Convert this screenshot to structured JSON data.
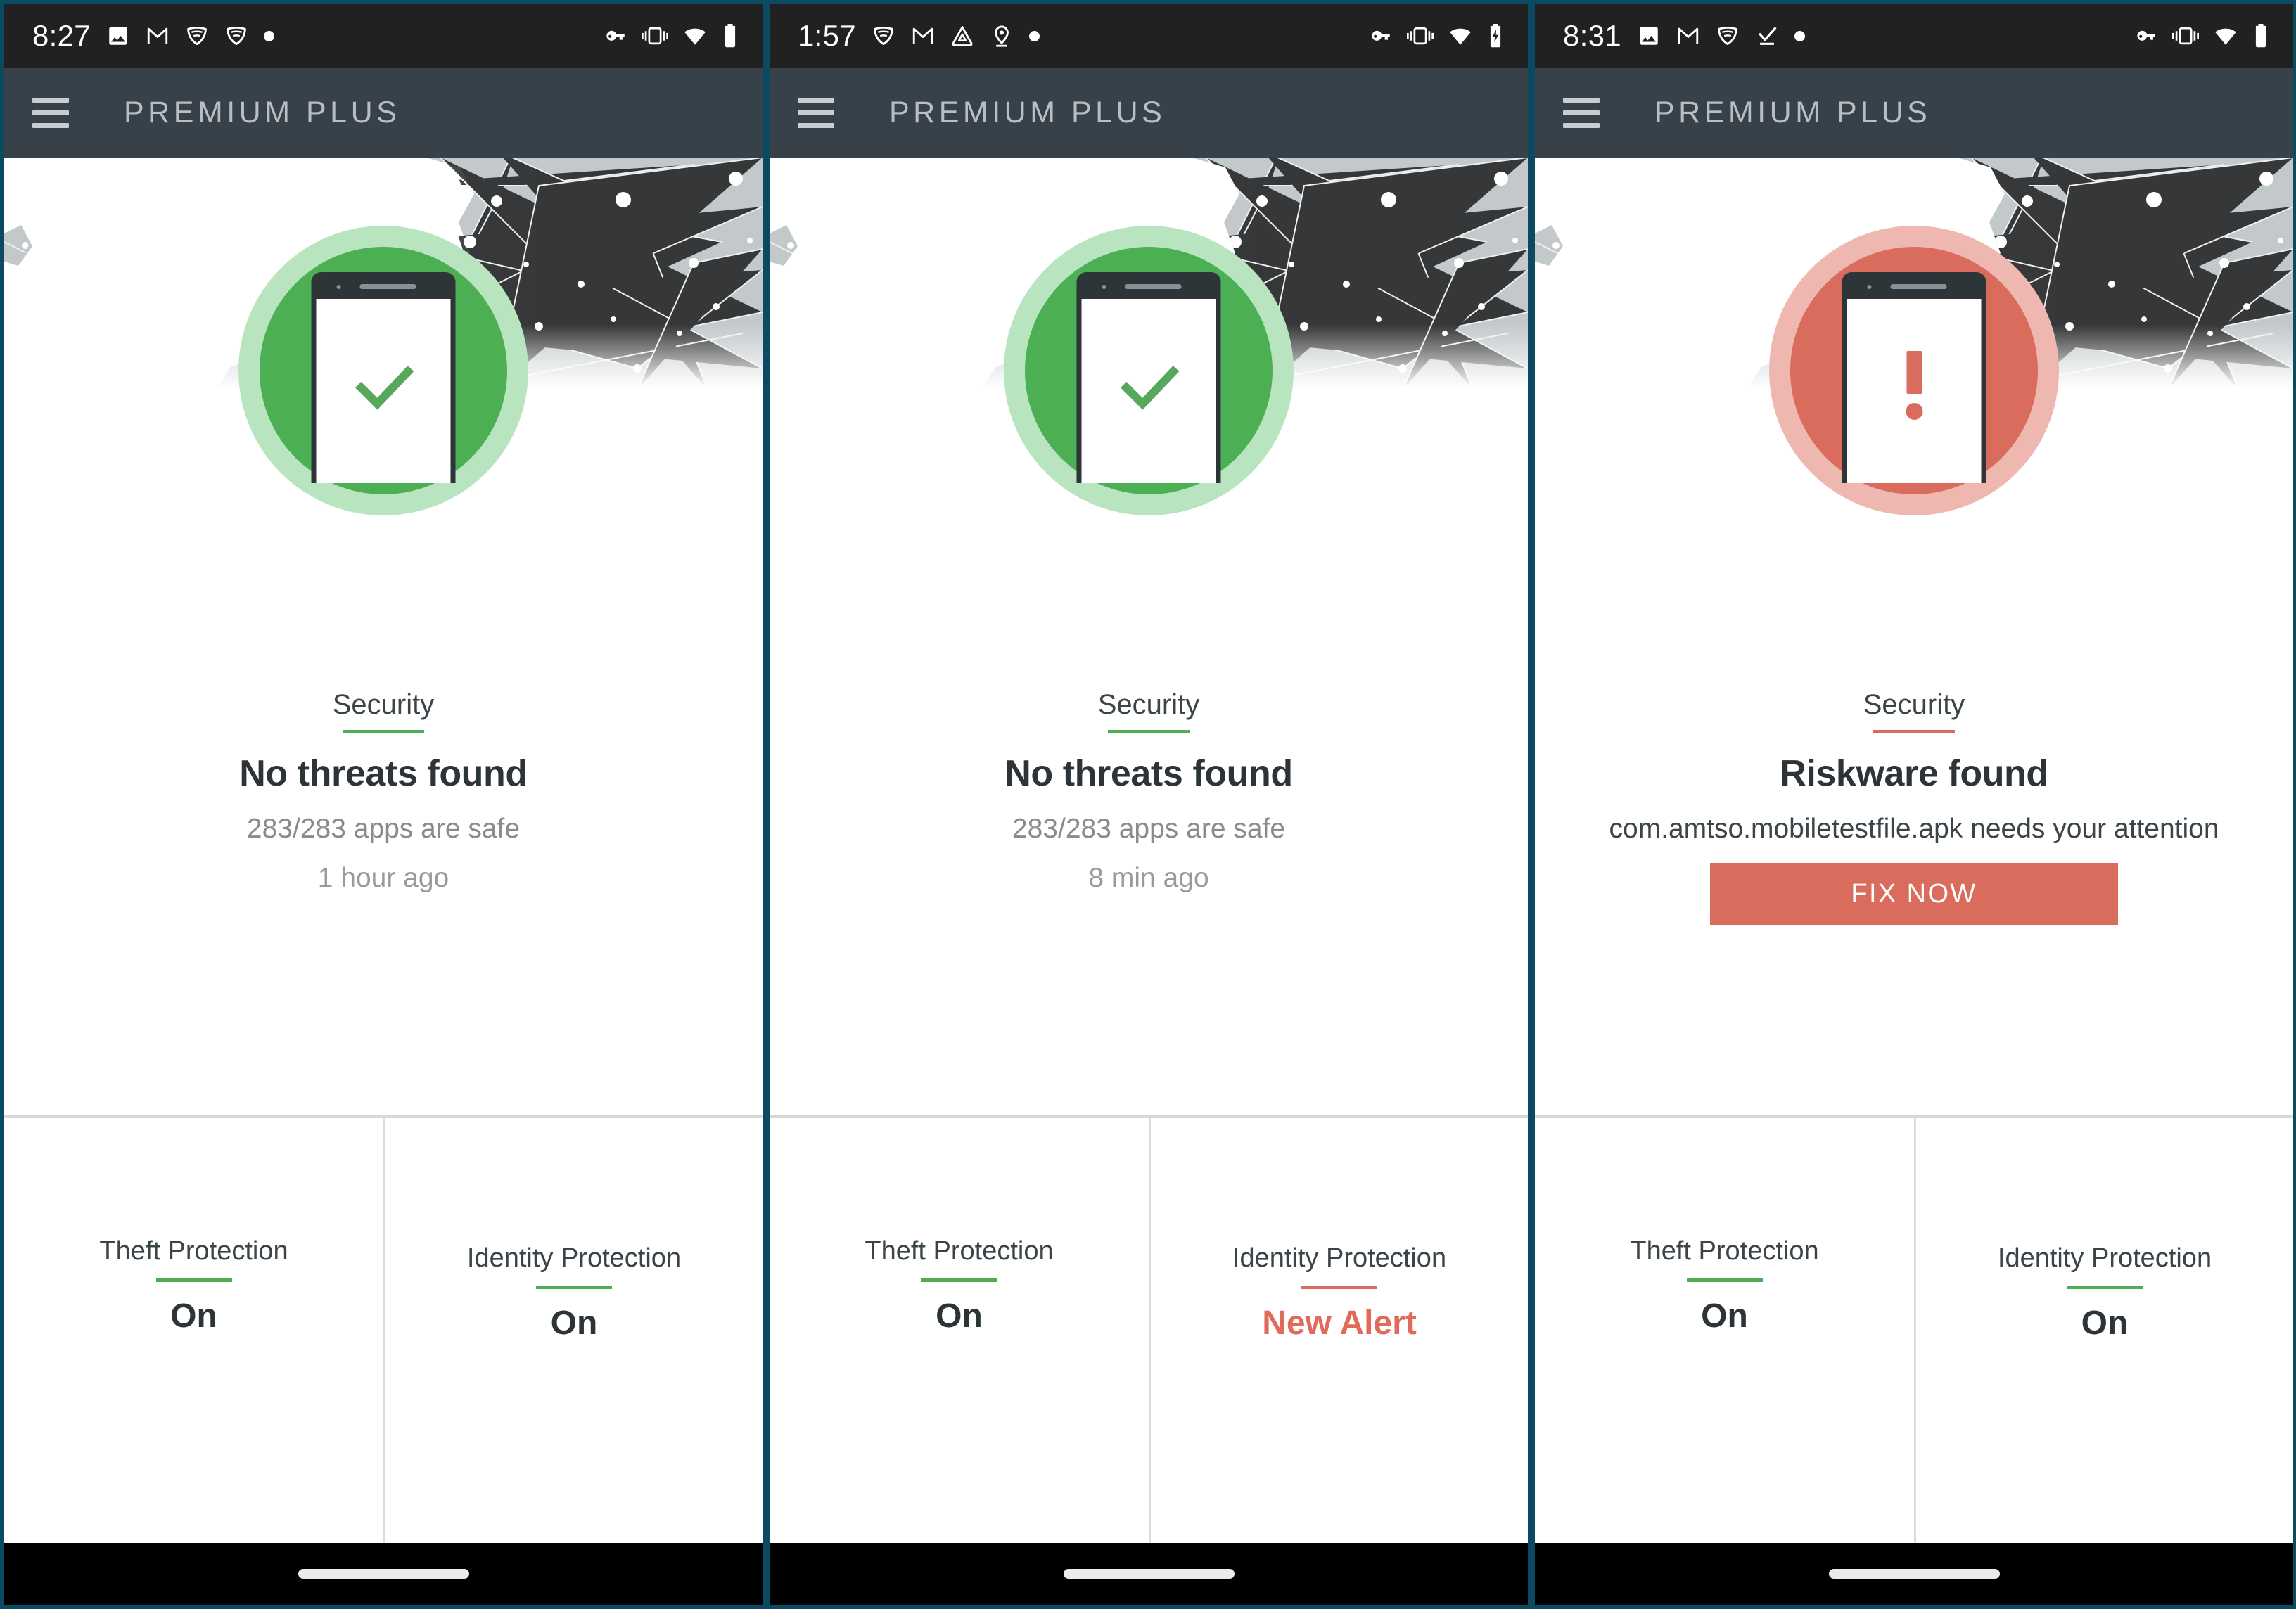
{
  "meta": {
    "accent_teal": "#0b4a60",
    "green": "#4caf54",
    "green_light": "#b8e5bf",
    "red": "#d96c5c",
    "red_light": "#eeb8b1",
    "appbar_bg": "#37414a",
    "statusbar_bg": "#212121",
    "navbar_bg": "#000000"
  },
  "panels": [
    {
      "status": {
        "clock": "8:27",
        "left_icons": [
          "image-icon",
          "gmail-icon",
          "shield-icon",
          "shield-icon",
          "dot-icon"
        ],
        "right_icons": [
          "vpn-key-icon",
          "vibrate-icon",
          "wifi-icon",
          "battery-icon"
        ]
      },
      "appbar": {
        "menu_icon": "hamburger-menu-icon",
        "title": "PREMIUM PLUS"
      },
      "hero": {
        "state": "green",
        "phone_glyph": "check-icon"
      },
      "security": {
        "label": "Security",
        "rule_color": "green",
        "headline": "No threats found",
        "subtitle": "283/283 apps are safe",
        "timestamp": "1 hour ago",
        "has_button": false,
        "button_label": ""
      },
      "cards": [
        {
          "title": "Theft Protection",
          "rule_color": "green",
          "value": "On",
          "value_state": "normal",
          "align": "hi"
        },
        {
          "title": "Identity Protection",
          "rule_color": "green",
          "value": "On",
          "value_state": "normal",
          "align": "lo"
        }
      ],
      "nav": {
        "home_indicator": "home-indicator"
      }
    },
    {
      "status": {
        "clock": "1:57",
        "left_icons": [
          "shield-icon",
          "gmail-icon",
          "drive-icon",
          "location-pin-icon",
          "dot-icon"
        ],
        "right_icons": [
          "vpn-key-icon",
          "vibrate-icon",
          "wifi-icon",
          "battery-charging-icon"
        ]
      },
      "appbar": {
        "menu_icon": "hamburger-menu-icon",
        "title": "PREMIUM PLUS"
      },
      "hero": {
        "state": "green",
        "phone_glyph": "check-icon"
      },
      "security": {
        "label": "Security",
        "rule_color": "green",
        "headline": "No threats found",
        "subtitle": "283/283 apps are safe",
        "timestamp": "8 min ago",
        "has_button": false,
        "button_label": ""
      },
      "cards": [
        {
          "title": "Theft Protection",
          "rule_color": "green",
          "value": "On",
          "value_state": "normal",
          "align": "hi"
        },
        {
          "title": "Identity Protection",
          "rule_color": "red",
          "value": "New Alert",
          "value_state": "alert",
          "align": "lo"
        }
      ],
      "nav": {
        "home_indicator": "home-indicator"
      }
    },
    {
      "status": {
        "clock": "8:31",
        "left_icons": [
          "image-icon",
          "gmail-icon",
          "shield-icon",
          "download-done-icon",
          "dot-icon"
        ],
        "right_icons": [
          "vpn-key-icon",
          "vibrate-icon",
          "wifi-icon",
          "battery-icon"
        ]
      },
      "appbar": {
        "menu_icon": "hamburger-menu-icon",
        "title": "PREMIUM PLUS"
      },
      "hero": {
        "state": "red",
        "phone_glyph": "exclamation-icon"
      },
      "security": {
        "label": "Security",
        "rule_color": "red",
        "headline": "Riskware found",
        "subtitle": "com.amtso.mobiletestfile.apk needs your attention",
        "timestamp": "",
        "has_button": true,
        "button_label": "FIX NOW"
      },
      "cards": [
        {
          "title": "Theft Protection",
          "rule_color": "green",
          "value": "On",
          "value_state": "normal",
          "align": "hi"
        },
        {
          "title": "Identity Protection",
          "rule_color": "green",
          "value": "On",
          "value_state": "normal",
          "align": "lo"
        }
      ],
      "nav": {
        "home_indicator": "home-indicator"
      }
    }
  ]
}
